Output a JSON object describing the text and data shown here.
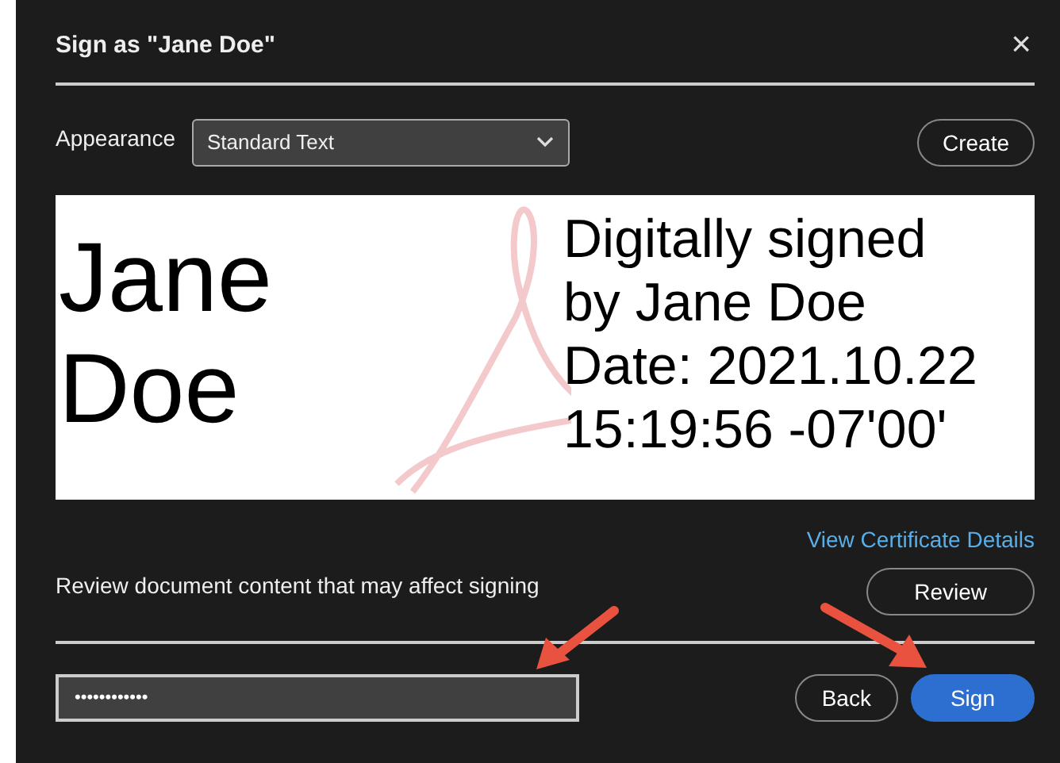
{
  "dialog": {
    "title": "Sign as \"Jane Doe\"",
    "close": "×"
  },
  "appearance": {
    "label": "Appearance",
    "value": "Standard Text",
    "button": "Create"
  },
  "preview": {
    "name_lines": [
      "Jane",
      "Doe"
    ],
    "detail_lines": [
      "Digitally signed",
      "by Jane Doe",
      "Date: 2021.10.22",
      "15:19:56 -07'00'"
    ]
  },
  "certificate_link": "View Certificate Details",
  "review": {
    "text": "Review document content that may affect signing",
    "button": "Review"
  },
  "password": {
    "value": "••••••••••••"
  },
  "buttons": [
    {
      "label": "Back",
      "kind": "secondary"
    },
    {
      "label": "Sign",
      "kind": "primary"
    }
  ]
}
